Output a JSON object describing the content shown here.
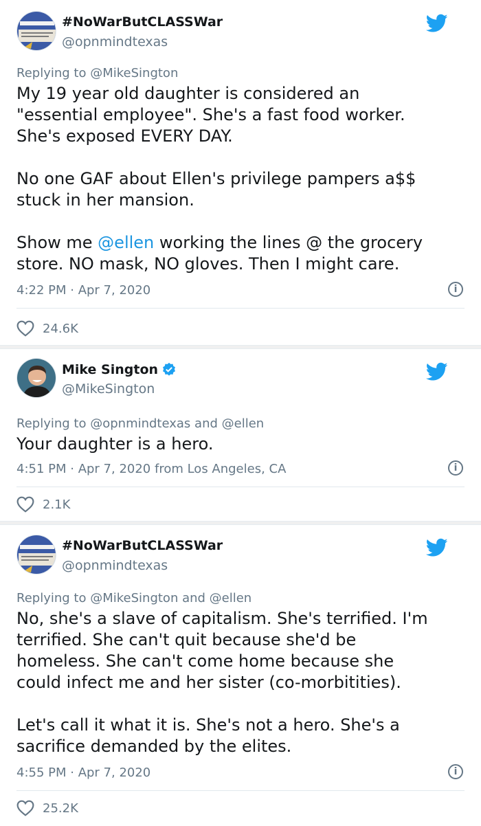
{
  "tweets": [
    {
      "name": "#NoWarButCLASSWar",
      "handle": "@opnmindtexas",
      "replying_prefix": "Replying to",
      "replying_to": "@MikeSington",
      "lines": [
        "My 19 year old daughter is considered an",
        "\"essential employee\". She's a fast food worker.",
        "She's exposed EVERY DAY.",
        "",
        "No one GAF about Ellen's privilege pampers a$$",
        "stuck in her mansion.",
        "",
        "Show me",
        "store. NO mask, NO gloves. Then I might care."
      ],
      "mention": "@ellen",
      "mention_after": "working the lines @ the grocery",
      "timestamp": "4:22 PM · Apr 7, 2020",
      "likes": "24.6K"
    },
    {
      "name": "Mike Sington",
      "handle": "@MikeSington",
      "replying_prefix": "Replying to",
      "replying_to": "@opnmindtexas and @ellen",
      "lines": [
        "Your daughter is a hero."
      ],
      "timestamp": "4:51 PM · Apr 7, 2020 from Los Angeles, CA",
      "likes": "2.1K"
    },
    {
      "name": "#NoWarButCLASSWar",
      "handle": "@opnmindtexas",
      "replying_prefix": "Replying to",
      "replying_to": "@MikeSington and @ellen",
      "lines": [
        "No, she's a slave of capitalism. She's terrified. I'm",
        "terrified. She can't quit because she'd be",
        "homeless. She can't come home because she",
        "could infect me and her sister (co-morbitities).",
        "",
        "Let's call it what it is. She's not a hero. She's a",
        "sacrifice demanded by the elites."
      ],
      "timestamp": "4:55 PM · Apr 7, 2020",
      "likes": "25.2K"
    }
  ],
  "icons": {
    "brand": "twitter-bird-icon",
    "info": "info-icon",
    "like": "heart-icon",
    "verified": "verified-badge-icon"
  },
  "colors": {
    "twitter_blue": "#1da1f2",
    "link": "#1b95e0",
    "secondary": "#657786"
  }
}
